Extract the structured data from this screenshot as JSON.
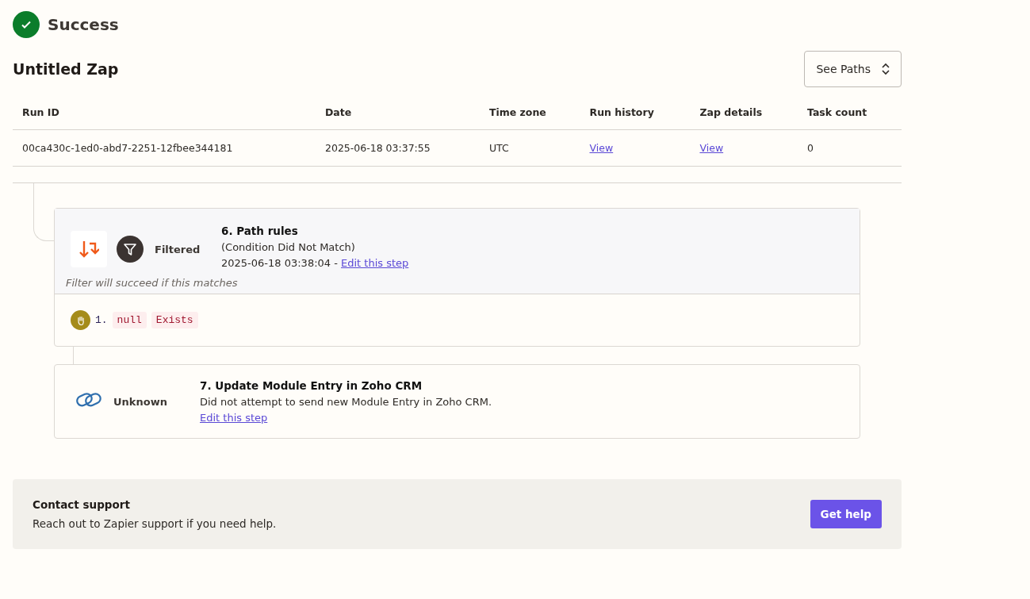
{
  "status": {
    "kind": "success",
    "label": "Success"
  },
  "title": "Untitled Zap",
  "paths_button": "See Paths",
  "table": {
    "columns": [
      "Run ID",
      "Date",
      "Time zone",
      "Run history",
      "Zap details",
      "Task count"
    ],
    "rows": [
      {
        "cells": [
          {
            "kind": "text",
            "text": "00ca430c-1ed0-abd7-2251-12fbee344181"
          },
          {
            "kind": "text",
            "text": "2025-06-18 03:37:55"
          },
          {
            "kind": "text",
            "text": "UTC"
          },
          {
            "kind": "link",
            "text": "View"
          },
          {
            "kind": "link",
            "text": "View"
          },
          {
            "kind": "text",
            "text": "0"
          }
        ]
      }
    ]
  },
  "steps": [
    {
      "kind": "filter",
      "status": "Filtered",
      "title": "6. Path rules",
      "subtitle": "(Condition Did Not Match)",
      "time": "2025-06-18 03:38:04 -",
      "link": "Edit this step",
      "rules_caption": "Filter will succeed if this matches",
      "rules": [
        {
          "number": "1.",
          "tokens": [
            "null",
            "Exists"
          ]
        }
      ]
    },
    {
      "kind": "action",
      "status": "Unknown",
      "title": "7. Update Module Entry in Zoho CRM",
      "description": "Did not attempt to send new Module Entry in Zoho CRM.",
      "link": "Edit this step"
    }
  ],
  "support": {
    "title": "Contact support",
    "text": "Reach out to Zapier support if you need help.",
    "button": "Get help"
  }
}
